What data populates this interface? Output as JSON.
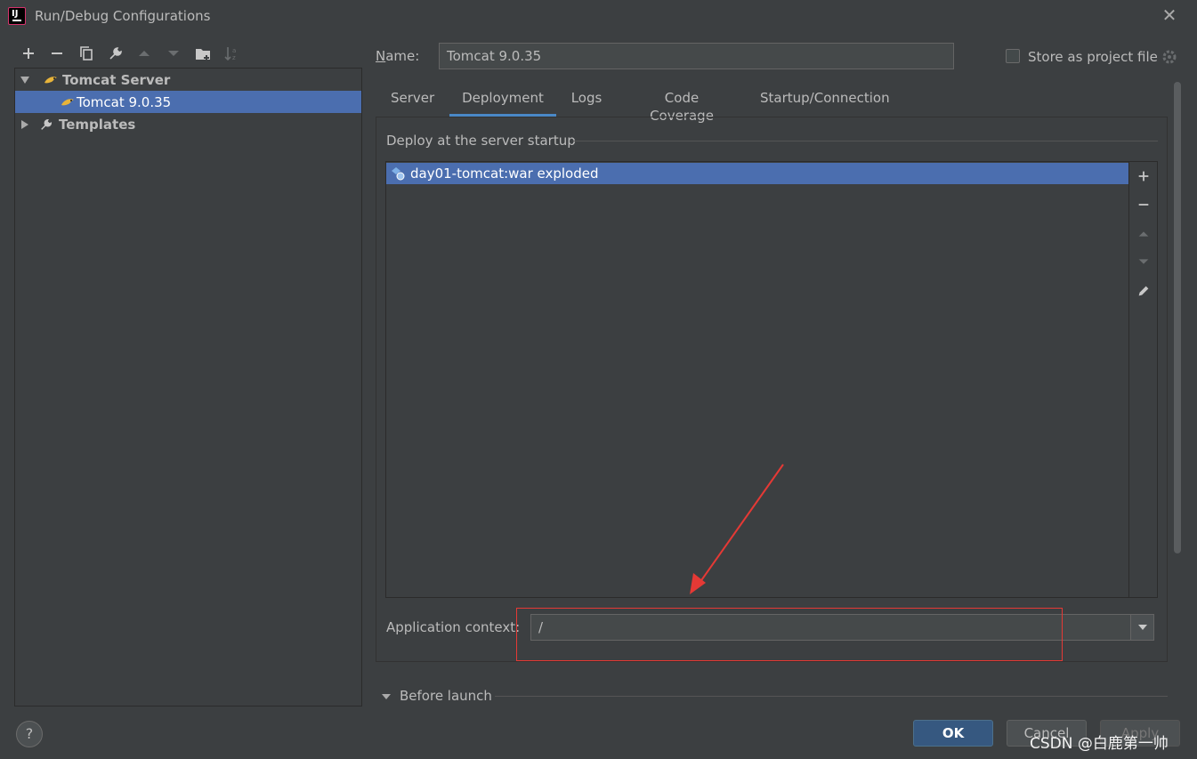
{
  "window": {
    "title": "Run/Debug Configurations"
  },
  "toolbar": {
    "icons": [
      "add-icon",
      "remove-icon",
      "copy-icon",
      "wrench-icon",
      "move-up-icon",
      "move-down-icon",
      "new-folder-icon",
      "sort-icon"
    ]
  },
  "tree": {
    "group_label": "Tomcat Server",
    "item_label": "Tomcat 9.0.35",
    "templates_label": "Templates"
  },
  "name_field": {
    "label": "Name:",
    "value": "Tomcat 9.0.35"
  },
  "store_project": {
    "label": "Store as project file",
    "checked": false
  },
  "tabs": [
    {
      "label": "Server",
      "active": false
    },
    {
      "label": "Deployment",
      "active": true
    },
    {
      "label": "Logs",
      "active": false
    },
    {
      "label": "Code Coverage",
      "active": false
    },
    {
      "label": "Startup/Connection",
      "active": false
    }
  ],
  "deployment": {
    "section_label": "Deploy at the server startup",
    "artifacts": [
      "day01-tomcat:war exploded"
    ],
    "context_label": "Application context:",
    "context_value": "/"
  },
  "before_launch": {
    "label": "Before launch"
  },
  "buttons": {
    "ok": "OK",
    "cancel": "Cancel",
    "apply": "Apply",
    "help": "?"
  },
  "watermark": "CSDN @白鹿第一帅",
  "colors": {
    "background": "#3c3f41",
    "selection": "#4b6eaf",
    "accent_tab": "#4a88c7",
    "ok_button": "#365880",
    "annotation_red": "#e53935"
  }
}
